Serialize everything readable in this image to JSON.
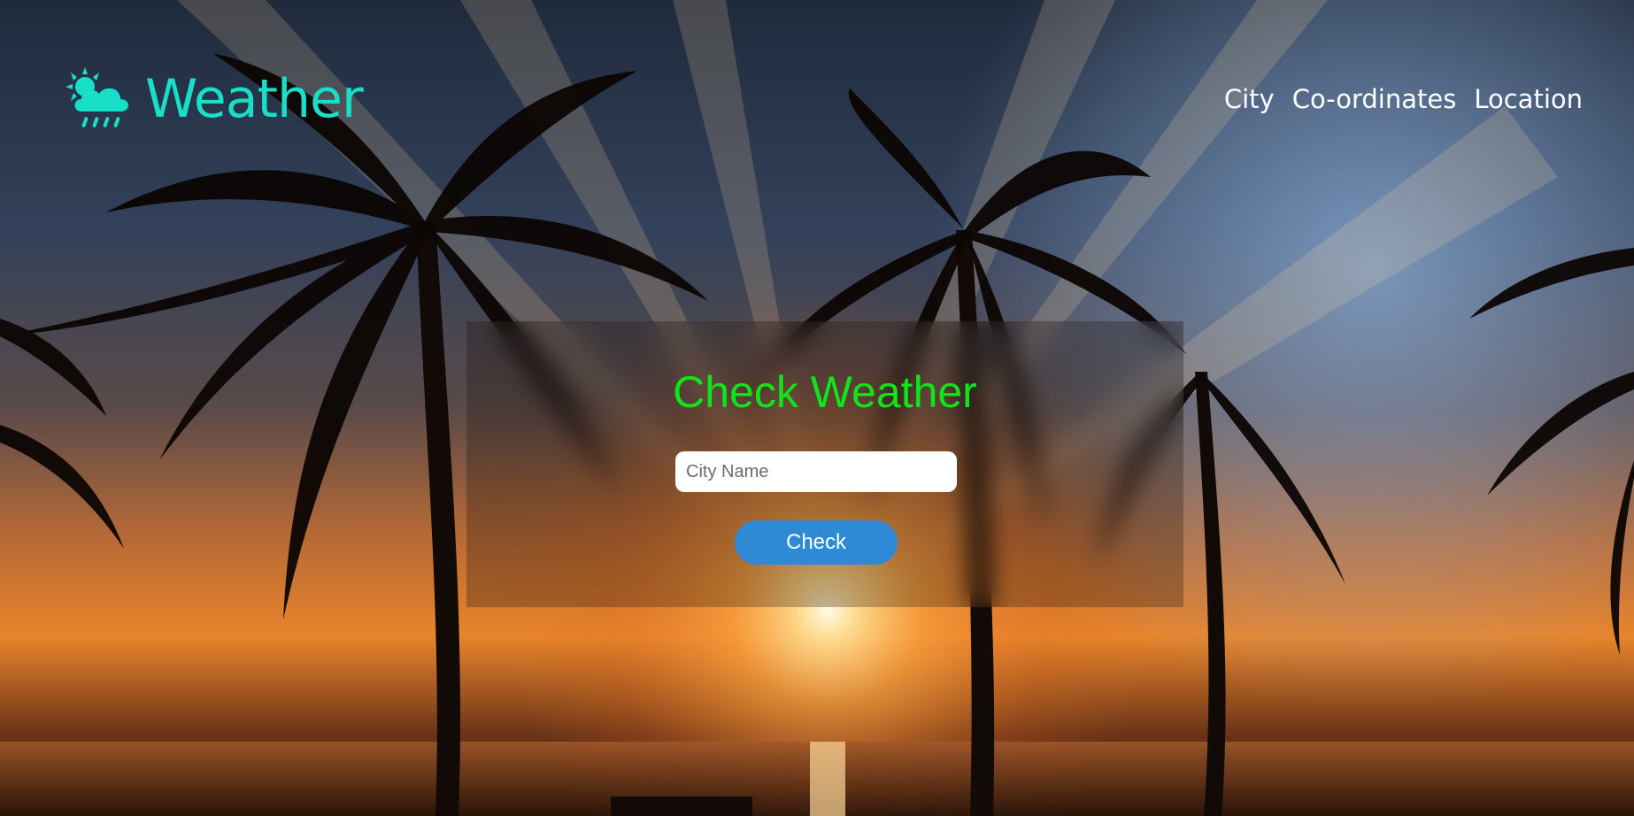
{
  "header": {
    "logo_text": "Weather",
    "logo_icon": "sun-cloud-rain-icon",
    "nav": [
      {
        "label": "City"
      },
      {
        "label": "Co-ordinates"
      },
      {
        "label": "Location"
      }
    ]
  },
  "card": {
    "title": "Check Weather",
    "input_placeholder": "City Name",
    "input_value": "",
    "button_label": "Check"
  },
  "colors": {
    "logo": "#18e0c8",
    "title": "#0ee61a",
    "button": "#2f8ad6",
    "nav_text": "#ffffff"
  }
}
